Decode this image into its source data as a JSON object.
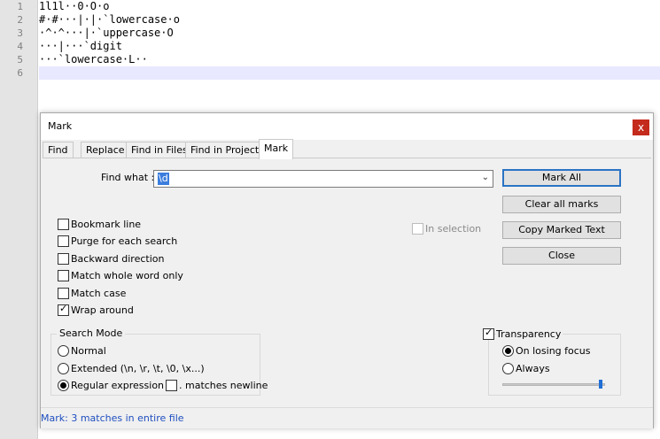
{
  "editor": {
    "line_numbers": [
      "1",
      "2",
      "3",
      "4",
      "5",
      "6"
    ],
    "lines": [
      "1l1l··0·O·o",
      "#·#···|·|·`lowercase·o",
      "·^·^···|·`uppercase·O",
      "···|···`digit",
      "···`lowercase·L··",
      ""
    ]
  },
  "dialog": {
    "title": "Mark",
    "close_label": "x",
    "tabs": [
      "Find",
      "Replace",
      "Find in Files",
      "Find in Projects",
      "Mark"
    ],
    "active_tab": "Mark",
    "find_what_label": "Find what :",
    "find_what_value": "\\d",
    "buttons": {
      "mark_all": "Mark All",
      "clear_all_marks": "Clear all marks",
      "copy_marked_text": "Copy Marked Text",
      "close": "Close"
    },
    "options": {
      "bookmark_line": "Bookmark line",
      "purge": "Purge for each search",
      "backward": "Backward direction",
      "whole_word": "Match whole word only",
      "match_case": "Match case",
      "wrap_around": "Wrap around",
      "in_selection": "In selection"
    },
    "search_mode": {
      "title": "Search Mode",
      "normal": "Normal",
      "extended": "Extended (\\n, \\r, \\t, \\0, \\x...)",
      "regex": "Regular expression",
      "dot_newline": ". matches newline"
    },
    "transparency": {
      "label": "Transparency",
      "on_losing_focus": "On losing focus",
      "always": "Always",
      "level": 0.97
    },
    "status": "Mark: 3 matches in entire file"
  }
}
